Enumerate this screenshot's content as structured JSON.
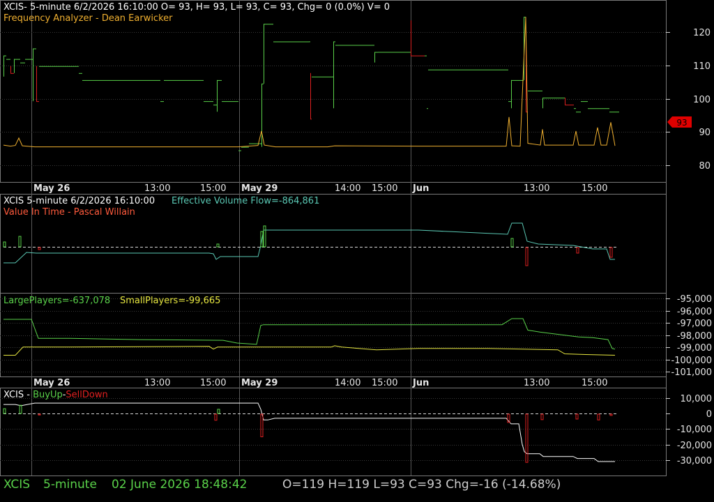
{
  "colors": {
    "background": "#000000",
    "border": "#7a7a7a",
    "grid": "#3a3a3a",
    "text": "#ffffff",
    "tick": "#e6e6e6",
    "up_green": "#5ad24a",
    "down_red": "#e02020",
    "freq_orange": "#f0b030",
    "flow_cyan": "#5ac8b4",
    "value_red": "#ff5a3c",
    "small_yellow": "#e8e840",
    "last_tag": "#e00000"
  },
  "price_panel": {
    "header": "XCIS- 5-minute 6/2/2026 16:10:00 O= 93, H= 93, L= 93, C= 93, Chg= 0 (0.0%) V= 0",
    "indicator": "Frequency Analyzer - Dean Earwicker",
    "last_value_tag": "93"
  },
  "time_axis": {
    "labels": [
      "May 26",
      "13:00",
      "15:00",
      "May 29",
      "14:00",
      "15:00",
      "Jun",
      "13:00",
      "15:00"
    ],
    "bold": [
      true,
      false,
      false,
      true,
      false,
      false,
      true,
      false,
      false
    ]
  },
  "flow_panel": {
    "symbol_line": "XCIS 5-minute  6/2/2026 16:10:00",
    "flow_label": "Effective Volume Flow=-864,861",
    "indicator": "Value In Time - Pascal Willain"
  },
  "players_panel": {
    "large_label": "LargePlayers=-637,078",
    "small_label": "SmallPlayers=-99,665"
  },
  "buy_panel": {
    "prefix": "XCIS - ",
    "buy_label": "BuyUp",
    "sep": "-",
    "sell_label": "SellDown"
  },
  "status_bar": {
    "symbol": "XCIS",
    "interval": "5-minute",
    "datetime": "02 June 2026 18:48:42",
    "ohlc": "O=119  H=119  L=93  C=93  Chg=-16 (-14.68%)"
  },
  "chart_data": [
    {
      "type": "line",
      "title": "XCIS 5-minute price with Frequency Analyzer",
      "y_axis_ticks": [
        "120",
        "110",
        "100",
        "90",
        "80"
      ],
      "ylim": [
        74,
        124
      ],
      "price_bars": [
        {
          "x": 5,
          "o": 103,
          "h": 109,
          "l": 103,
          "c": 109
        },
        {
          "x": 9,
          "o": 108,
          "h": 108,
          "l": 108,
          "c": 108
        },
        {
          "x": 15,
          "o": 106,
          "h": 106,
          "l": 104,
          "c": 104
        },
        {
          "x": 20,
          "o": 104,
          "h": 108,
          "l": 104,
          "c": 108
        },
        {
          "x": 29,
          "o": 107,
          "h": 107,
          "l": 107,
          "c": 107
        },
        {
          "x": 36,
          "o": 108,
          "h": 108,
          "l": 108,
          "c": 108
        },
        {
          "x": 44,
          "o": 108,
          "h": 108,
          "l": 108,
          "c": 108
        },
        {
          "x": 47,
          "o": 96,
          "h": 111,
          "l": 96,
          "c": 111
        },
        {
          "x": 52,
          "o": 106,
          "h": 106,
          "l": 96,
          "c": 96
        },
        {
          "x": 56,
          "o": 106,
          "h": 106,
          "l": 106,
          "c": 106
        },
        {
          "x": 110,
          "o": 106,
          "h": 106,
          "l": 106,
          "c": 106
        },
        {
          "x": 113,
          "o": 104,
          "h": 104,
          "l": 104,
          "c": 104
        },
        {
          "x": 118,
          "o": 102,
          "h": 102,
          "l": 102,
          "c": 102
        },
        {
          "x": 175,
          "o": 102,
          "h": 102,
          "l": 102,
          "c": 102
        },
        {
          "x": 230,
          "o": 96,
          "h": 96,
          "l": 96,
          "c": 96
        },
        {
          "x": 235,
          "o": 102,
          "h": 102,
          "l": 102,
          "c": 102
        },
        {
          "x": 292,
          "o": 96,
          "h": 96,
          "l": 96,
          "c": 96
        },
        {
          "x": 306,
          "o": 95,
          "h": 95,
          "l": 95,
          "c": 95
        },
        {
          "x": 311,
          "o": 93,
          "h": 102,
          "l": 93,
          "c": 102
        },
        {
          "x": 318,
          "o": 96,
          "h": 96,
          "l": 96,
          "c": 96
        },
        {
          "x": 322,
          "o": 96,
          "h": 96,
          "l": 96,
          "c": 96
        },
        {
          "x": 342,
          "o": 82,
          "h": 82,
          "l": 82,
          "c": 82
        },
        {
          "x": 346,
          "o": 83,
          "h": 83,
          "l": 83,
          "c": 83
        },
        {
          "x": 353,
          "o": 83,
          "h": 83,
          "l": 83,
          "c": 83
        },
        {
          "x": 357,
          "o": 84,
          "h": 84,
          "l": 84,
          "c": 84
        },
        {
          "x": 370,
          "o": 84,
          "h": 84,
          "l": 84,
          "c": 84
        },
        {
          "x": 375,
          "o": 83,
          "h": 101,
          "l": 83,
          "c": 101
        },
        {
          "x": 378,
          "o": 101,
          "h": 118,
          "l": 101,
          "c": 118
        },
        {
          "x": 392,
          "o": 113,
          "h": 113,
          "l": 113,
          "c": 113
        },
        {
          "x": 443,
          "o": 113,
          "h": 113,
          "l": 113,
          "c": 113
        },
        {
          "x": 445,
          "o": 104,
          "h": 104,
          "l": 91,
          "c": 91
        },
        {
          "x": 447,
          "o": 103,
          "h": 103,
          "l": 103,
          "c": 103
        },
        {
          "x": 476,
          "o": 103,
          "h": 103,
          "l": 103,
          "c": 103
        },
        {
          "x": 478,
          "o": 94,
          "h": 113,
          "l": 94,
          "c": 113
        },
        {
          "x": 481,
          "o": 112,
          "h": 112,
          "l": 112,
          "c": 112
        },
        {
          "x": 533,
          "o": 112,
          "h": 112,
          "l": 112,
          "c": 112
        },
        {
          "x": 537,
          "o": 107,
          "h": 110,
          "l": 107,
          "c": 110
        },
        {
          "x": 542,
          "o": 110,
          "h": 110,
          "l": 110,
          "c": 110
        },
        {
          "x": 565,
          "o": 110,
          "h": 110,
          "l": 110,
          "c": 110
        },
        {
          "x": 589,
          "o": 119,
          "h": 119,
          "l": 109,
          "c": 109
        },
        {
          "x": 609,
          "o": 109,
          "h": 109,
          "l": 109,
          "c": 109
        },
        {
          "x": 612,
          "o": 94,
          "h": 94,
          "l": 94,
          "c": 94
        },
        {
          "x": 614,
          "o": 105,
          "h": 105,
          "l": 105,
          "c": 105
        },
        {
          "x": 726,
          "o": 105,
          "h": 105,
          "l": 105,
          "c": 105
        },
        {
          "x": 729,
          "o": 96,
          "h": 96,
          "l": 96,
          "c": 96
        },
        {
          "x": 733,
          "o": 94,
          "h": 102,
          "l": 94,
          "c": 102
        },
        {
          "x": 751,
          "o": 102,
          "h": 120,
          "l": 102,
          "c": 120
        },
        {
          "x": 754,
          "o": 116,
          "h": 116,
          "l": 93,
          "c": 93
        },
        {
          "x": 757,
          "o": 99,
          "h": 99,
          "l": 99,
          "c": 99
        },
        {
          "x": 775,
          "o": 99,
          "h": 99,
          "l": 99,
          "c": 99
        },
        {
          "x": 778,
          "o": 94,
          "h": 97,
          "l": 94,
          "c": 97
        },
        {
          "x": 810,
          "o": 97,
          "h": 97,
          "l": 95,
          "c": 95
        },
        {
          "x": 823,
          "o": 94,
          "h": 94,
          "l": 94,
          "c": 94
        },
        {
          "x": 826,
          "o": 93,
          "h": 93,
          "l": 93,
          "c": 93
        },
        {
          "x": 833,
          "o": 96,
          "h": 96,
          "l": 96,
          "c": 96
        },
        {
          "x": 843,
          "o": 94,
          "h": 94,
          "l": 94,
          "c": 94
        },
        {
          "x": 874,
          "o": 93,
          "h": 93,
          "l": 93,
          "c": 93
        },
        {
          "x": 885,
          "o": 93,
          "h": 93,
          "l": 93,
          "c": 93
        }
      ],
      "frequency_analyzer": [
        [
          5,
          83.5
        ],
        [
          15,
          83.2
        ],
        [
          22,
          83.4
        ],
        [
          27,
          85.5
        ],
        [
          32,
          83.3
        ],
        [
          50,
          83
        ],
        [
          160,
          83
        ],
        [
          300,
          83
        ],
        [
          342,
          83
        ],
        [
          370,
          83.4
        ],
        [
          375,
          87.5
        ],
        [
          379,
          83.5
        ],
        [
          395,
          83
        ],
        [
          470,
          83
        ],
        [
          480,
          83.3
        ],
        [
          600,
          83.2
        ],
        [
          726,
          83.2
        ],
        [
          730,
          91.5
        ],
        [
          734,
          83.3
        ],
        [
          746,
          83.2
        ],
        [
          750,
          102
        ],
        [
          754,
          120
        ],
        [
          757,
          84
        ],
        [
          775,
          83.5
        ],
        [
          778,
          88
        ],
        [
          781,
          83.5
        ],
        [
          822,
          83.5
        ],
        [
          826,
          87.5
        ],
        [
          830,
          83.5
        ],
        [
          852,
          83.5
        ],
        [
          857,
          88.5
        ],
        [
          862,
          83.5
        ],
        [
          870,
          83.5
        ],
        [
          876,
          90
        ],
        [
          882,
          83.3
        ]
      ]
    },
    {
      "type": "line",
      "title": "Effective Volume Flow / Value In Time",
      "flow_line": [
        [
          5,
          377
        ],
        [
          22,
          377
        ],
        [
          38,
          362
        ],
        [
          52,
          363
        ],
        [
          300,
          363
        ],
        [
          306,
          364
        ],
        [
          310,
          372
        ],
        [
          316,
          368
        ],
        [
          370,
          368
        ],
        [
          374,
          352
        ],
        [
          378,
          330
        ],
        [
          600,
          330
        ],
        [
          728,
          336
        ],
        [
          734,
          320
        ],
        [
          749,
          320
        ],
        [
          756,
          346
        ],
        [
          772,
          350
        ],
        [
          822,
          352
        ],
        [
          850,
          357
        ],
        [
          870,
          357
        ],
        [
          875,
          372
        ],
        [
          882,
          372
        ]
      ],
      "up_bars": [
        [
          5,
          -7
        ],
        [
          27,
          -15
        ],
        [
          311,
          -4
        ],
        [
          374,
          -22
        ],
        [
          378,
          -30
        ],
        [
          733,
          -12
        ]
      ],
      "down_bars": [
        [
          55,
          3
        ],
        [
          754,
          26
        ],
        [
          827,
          8
        ],
        [
          875,
          14
        ]
      ]
    },
    {
      "type": "line",
      "title": "LargePlayers / SmallPlayers",
      "y_axis_ticks": [
        "-95,000",
        "-96,000",
        "-97,000",
        "-98,000",
        "-99,000",
        "-100,000",
        "-101,000"
      ],
      "ylim": [
        -101300,
        -94700
      ],
      "large_players": [
        [
          5,
          -96712
        ],
        [
          45,
          -96712
        ],
        [
          55,
          -98268
        ],
        [
          100,
          -98268
        ],
        [
          200,
          -98378
        ],
        [
          320,
          -98433
        ],
        [
          340,
          -98656
        ],
        [
          368,
          -98767
        ],
        [
          374,
          -97212
        ],
        [
          378,
          -97156
        ],
        [
          470,
          -97156
        ],
        [
          720,
          -97156
        ],
        [
          734,
          -96656
        ],
        [
          745,
          -96656
        ],
        [
          750,
          -96656
        ],
        [
          757,
          -97600
        ],
        [
          775,
          -97767
        ],
        [
          830,
          -98156
        ],
        [
          850,
          -98212
        ],
        [
          872,
          -98378
        ],
        [
          878,
          -99100
        ],
        [
          882,
          -99156
        ]
      ],
      "small_players": [
        [
          5,
          -99656
        ],
        [
          22,
          -99656
        ],
        [
          33,
          -98989
        ],
        [
          100,
          -98989
        ],
        [
          300,
          -98933
        ],
        [
          306,
          -99156
        ],
        [
          312,
          -98989
        ],
        [
          370,
          -98989
        ],
        [
          375,
          -98989
        ],
        [
          475,
          -98989
        ],
        [
          480,
          -98878
        ],
        [
          490,
          -98989
        ],
        [
          540,
          -99211
        ],
        [
          600,
          -99100
        ],
        [
          700,
          -99100
        ],
        [
          800,
          -99211
        ],
        [
          810,
          -99544
        ],
        [
          840,
          -99600
        ],
        [
          882,
          -99656
        ]
      ]
    },
    {
      "type": "line",
      "title": "BuyUp / SellDown",
      "y_axis_ticks": [
        "10,000",
        "0",
        "-10,000",
        "-20,000",
        "-30,000"
      ],
      "ylim": [
        -33000,
        12500
      ],
      "cumulative": [
        [
          5,
          5800
        ],
        [
          22,
          5800
        ],
        [
          30,
          5000
        ],
        [
          50,
          6700
        ],
        [
          370,
          6700
        ],
        [
          374,
          2700
        ],
        [
          378,
          -4200
        ],
        [
          384,
          -4200
        ],
        [
          394,
          -3100
        ],
        [
          600,
          -3100
        ],
        [
          726,
          -3100
        ],
        [
          733,
          -6700
        ],
        [
          744,
          -6700
        ],
        [
          749,
          -20000
        ],
        [
          752,
          -24700
        ],
        [
          756,
          -26000
        ],
        [
          774,
          -26000
        ],
        [
          779,
          -27800
        ],
        [
          822,
          -27800
        ],
        [
          828,
          -29100
        ],
        [
          852,
          -29100
        ],
        [
          858,
          -31100
        ],
        [
          882,
          -31100
        ]
      ],
      "buy_bars": [
        [
          5,
          3100
        ],
        [
          28,
          5300
        ],
        [
          312,
          2700
        ]
      ],
      "sell_bars": [
        [
          55,
          -1000
        ],
        [
          308,
          -4400
        ],
        [
          374,
          -15100
        ],
        [
          728,
          -5800
        ],
        [
          754,
          -31600
        ],
        [
          776,
          -4000
        ],
        [
          826,
          -3600
        ],
        [
          857,
          -4200
        ],
        [
          875,
          -1300
        ]
      ]
    }
  ]
}
